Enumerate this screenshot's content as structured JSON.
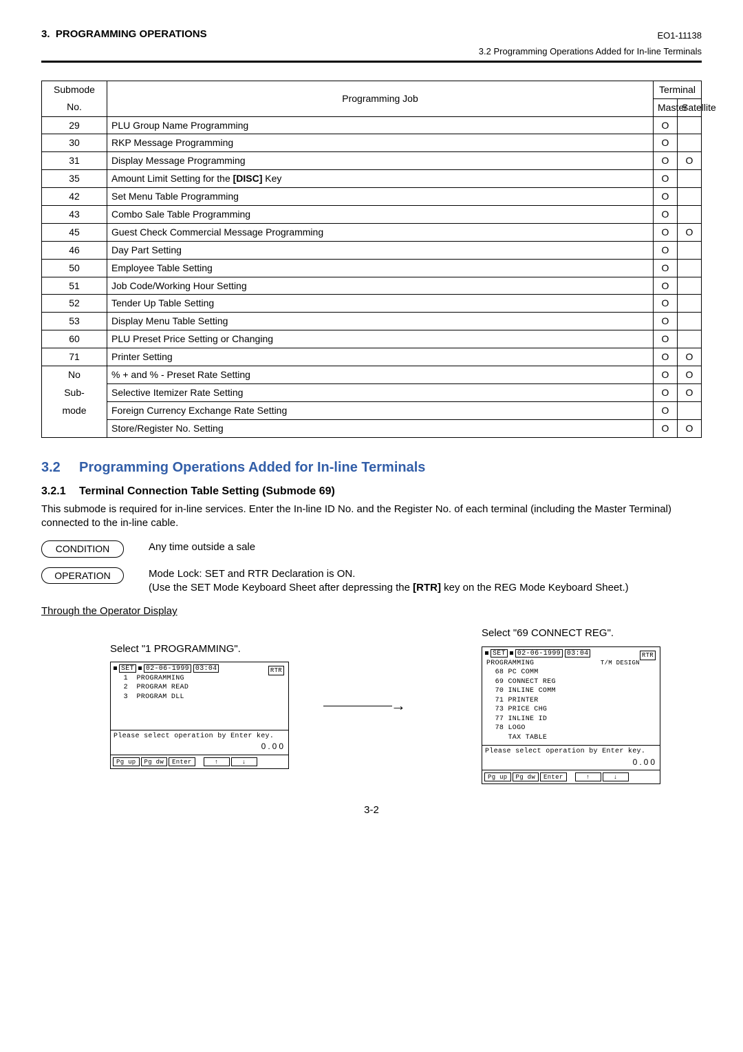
{
  "header": {
    "chapter": "3.",
    "title": "PROGRAMMING OPERATIONS",
    "docno": "EO1-11138",
    "sub": "3.2  Programming Operations Added for In-line Terminals"
  },
  "table": {
    "head": {
      "submode": "Submode",
      "job": "Programming Job",
      "terminal": "Terminal",
      "no": "No.",
      "master": "Master",
      "satellite": "Satellite"
    },
    "rows": [
      {
        "no": "29",
        "job": "PLU Group Name Programming",
        "m": "O",
        "s": ""
      },
      {
        "no": "30",
        "job": "RKP Message Programming",
        "m": "O",
        "s": ""
      },
      {
        "no": "31",
        "job": "Display Message Programming",
        "m": "O",
        "s": "O"
      },
      {
        "no": "35",
        "job": "Amount Limit Setting for the [DISC] Key",
        "m": "O",
        "s": ""
      },
      {
        "no": "42",
        "job": "Set Menu Table Programming",
        "m": "O",
        "s": ""
      },
      {
        "no": "43",
        "job": "Combo Sale Table Programming",
        "m": "O",
        "s": ""
      },
      {
        "no": "45",
        "job": "Guest Check Commercial Message Programming",
        "m": "O",
        "s": "O"
      },
      {
        "no": "46",
        "job": "Day Part Setting",
        "m": "O",
        "s": ""
      },
      {
        "no": "50",
        "job": "Employee Table Setting",
        "m": "O",
        "s": ""
      },
      {
        "no": "51",
        "job": "Job Code/Working Hour Setting",
        "m": "O",
        "s": ""
      },
      {
        "no": "52",
        "job": "Tender Up Table Setting",
        "m": "O",
        "s": ""
      },
      {
        "no": "53",
        "job": "Display Menu Table Setting",
        "m": "O",
        "s": ""
      },
      {
        "no": "60",
        "job": "PLU Preset Price Setting or Changing",
        "m": "O",
        "s": ""
      },
      {
        "no": "71",
        "job": "Printer Setting",
        "m": "O",
        "s": "O"
      },
      {
        "no": "No",
        "job": "% + and % - Preset Rate Setting",
        "m": "O",
        "s": "O"
      },
      {
        "no": "Sub-",
        "job": "Selective Itemizer Rate Setting",
        "m": "O",
        "s": "O"
      },
      {
        "no": "mode",
        "job": "Foreign Currency Exchange Rate Setting",
        "m": "O",
        "s": ""
      },
      {
        "no": "",
        "job": "Store/Register No. Setting",
        "m": "O",
        "s": "O"
      }
    ]
  },
  "sec32": {
    "num": "3.2",
    "title": "Programming Operations Added for In-line Terminals"
  },
  "sec321": {
    "num": "3.2.1",
    "title": "Terminal Connection Table Setting (Submode 69)",
    "body": "This submode is required for in-line services. Enter the In-line ID No. and the Register No. of each terminal (including the Master Terminal) connected to the in-line cable."
  },
  "condition": {
    "label": "CONDITION",
    "text": "Any time outside a sale"
  },
  "operation": {
    "label": "OPERATION",
    "line1": "Mode Lock:  SET and RTR Declaration is ON.",
    "line2_pre": "(Use the SET Mode Keyboard Sheet after depressing the ",
    "line2_key": "[RTR]",
    "line2_post": " key on the REG Mode Keyboard Sheet.)"
  },
  "through": "Through the Operator Display",
  "screens": {
    "left": {
      "caption": "Select \"1 PROGRAMMING\".",
      "status": {
        "set": "SET",
        "date": "02-06-1999",
        "time": "03:04"
      },
      "rtr": "RTR",
      "lines": [
        "  1  PROGRAMMING",
        "  2  PROGRAM READ",
        "  3  PROGRAM DLL"
      ],
      "prompt": "Please select operation by Enter key.",
      "amount": "0.00",
      "btns": [
        "Pg up",
        "Pg dw",
        "Enter",
        "↑",
        "↓"
      ]
    },
    "right": {
      "caption": "Select \"69 CONNECT REG\".",
      "status": {
        "set": "SET",
        "date": "02-06-1999",
        "time": "03:04"
      },
      "rtr": "RTR",
      "title": "PROGRAMMING",
      "tm": "T/M DESIGN",
      "lines": [
        "  68 PC COMM",
        "  69 CONNECT REG",
        "  70 INLINE COMM",
        "  71 PRINTER",
        "  73 PRICE CHG",
        "  77 INLINE ID",
        "  78 LOGO",
        "     TAX TABLE"
      ],
      "prompt": "Please select operation by Enter key.",
      "amount": "0.00",
      "btns": [
        "Pg up",
        "Pg dw",
        "Enter",
        "↑",
        "↓"
      ]
    }
  },
  "pagenum": "3-2"
}
